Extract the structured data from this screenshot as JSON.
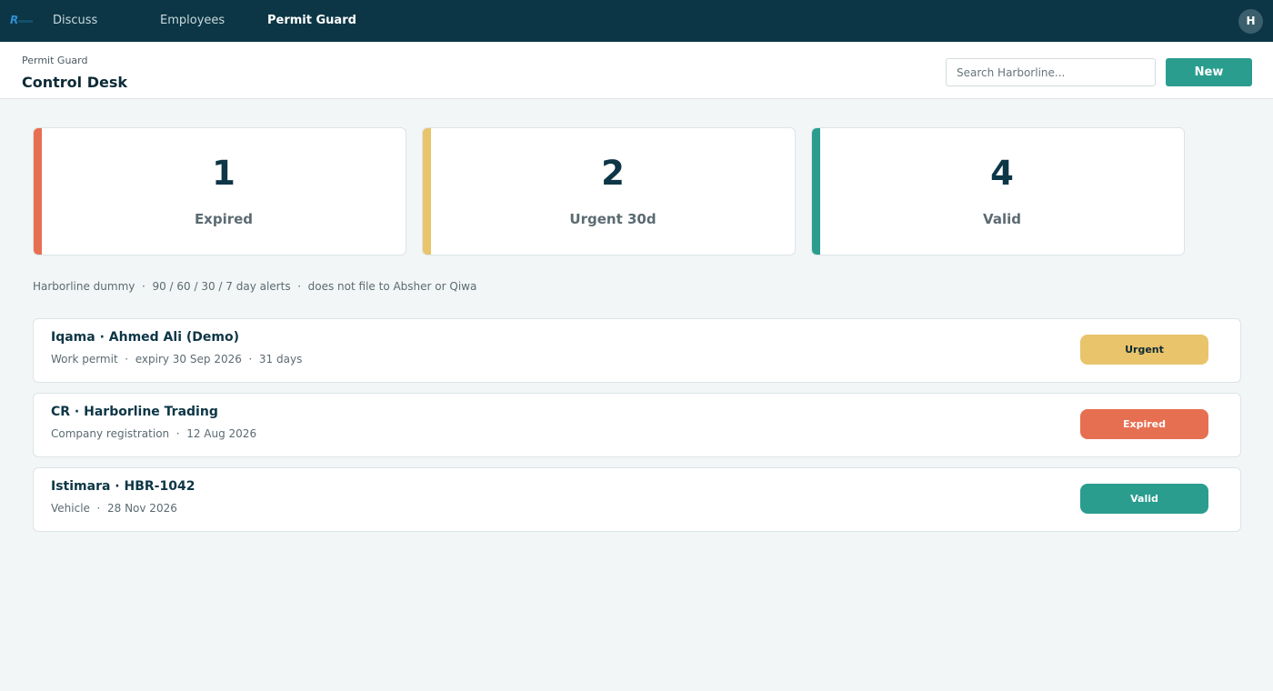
{
  "nav": {
    "items": [
      {
        "label": "Discuss",
        "active": false
      },
      {
        "label": "Employees",
        "active": false
      },
      {
        "label": "Permit Guard",
        "active": true
      }
    ],
    "avatar_initial": "H"
  },
  "header": {
    "breadcrumb": "Permit Guard",
    "title": "Control Desk",
    "search_placeholder": "Search Harborline...",
    "new_label": "New"
  },
  "stats": [
    {
      "value": "1",
      "label": "Expired",
      "color": "#e76f51"
    },
    {
      "value": "2",
      "label": "Urgent 30d",
      "color": "#e9c46a"
    },
    {
      "value": "4",
      "label": "Valid",
      "color": "#2a9d8f"
    }
  ],
  "meta_line": "Harborline dummy  ·  90 / 60 / 30 / 7 day alerts  ·  does not file to Absher or Qiwa",
  "permits": [
    {
      "title": "Iqama · Ahmed Ali (Demo)",
      "subtitle": "Work permit  ·  expiry 30 Sep 2026  ·  31 days",
      "status": "Urgent",
      "status_color": "#e9c46a",
      "status_text_color": "#0d2a36"
    },
    {
      "title": "CR · Harborline Trading",
      "subtitle": "Company registration  ·  12 Aug 2026",
      "status": "Expired",
      "status_color": "#e76f51",
      "status_text_color": "#ffffff"
    },
    {
      "title": "Istimara · HBR-1042",
      "subtitle": "Vehicle  ·  28 Nov 2026",
      "status": "Valid",
      "status_color": "#2a9d8f",
      "status_text_color": "#ffffff"
    }
  ]
}
